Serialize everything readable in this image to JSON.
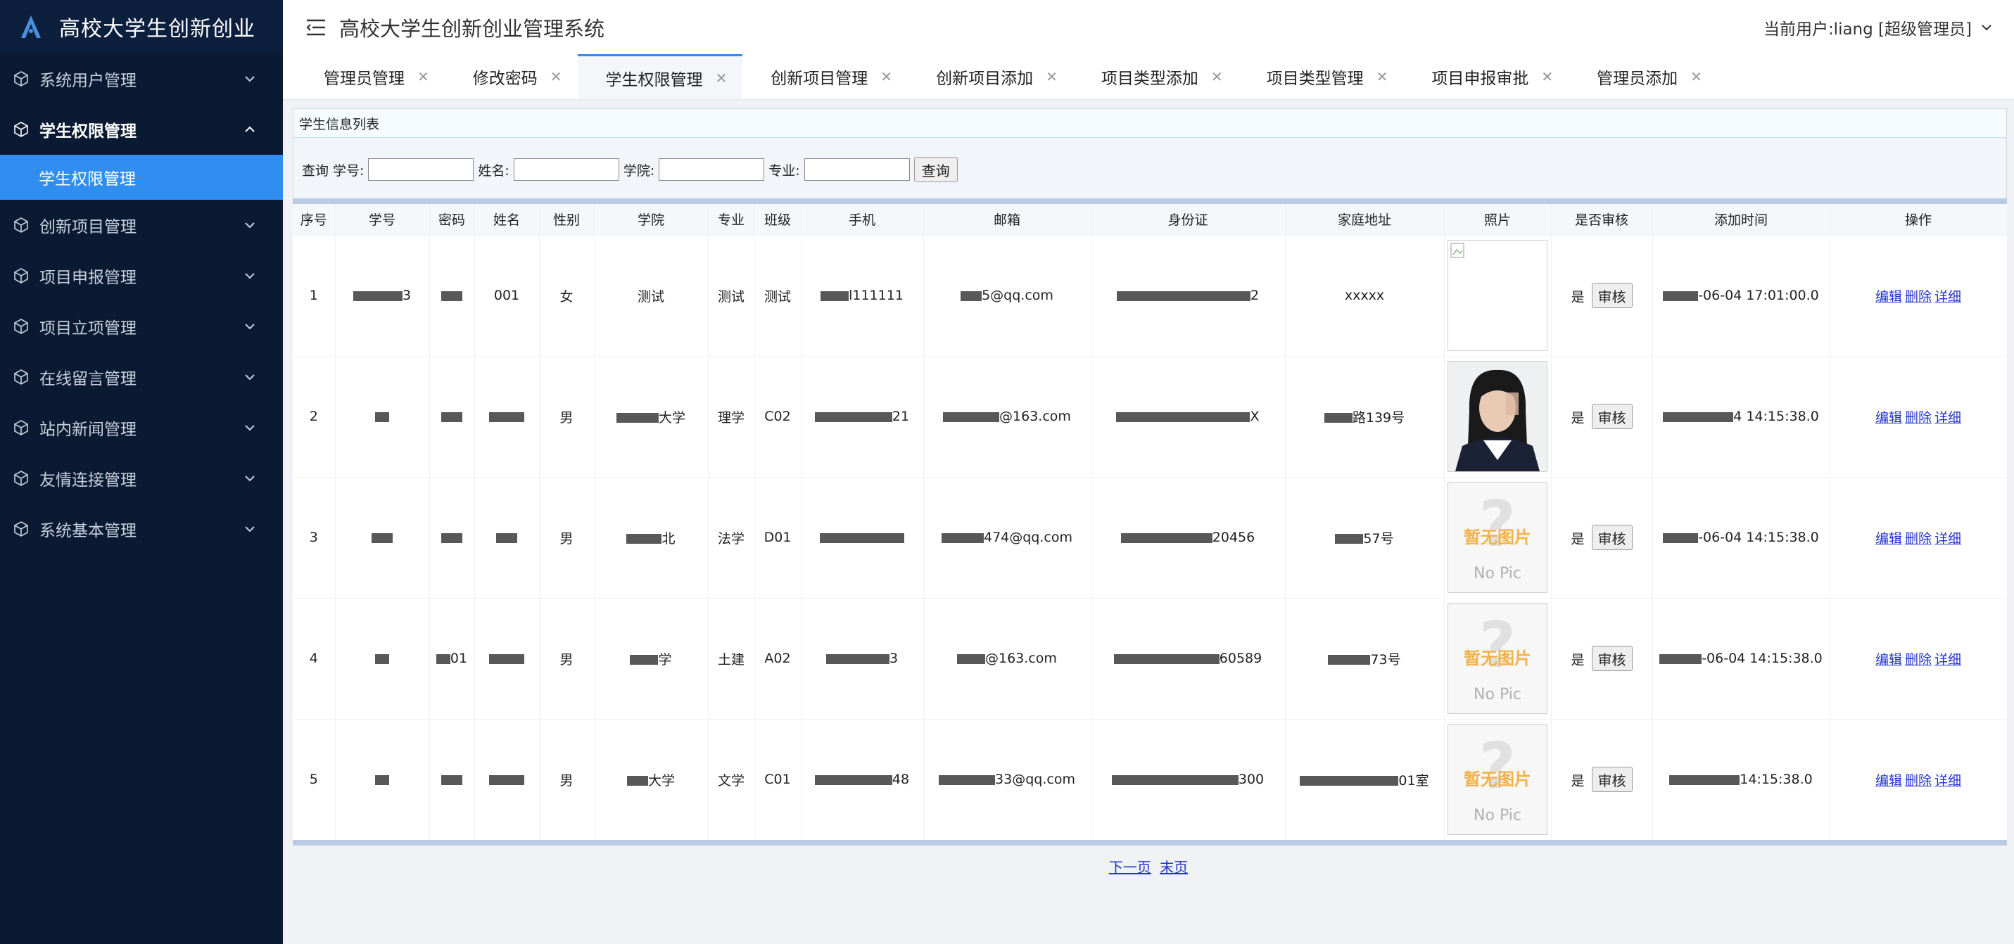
{
  "brand": {
    "title": "高校大学生创新创业"
  },
  "header": {
    "title": "高校大学生创新创业管理系统",
    "user": "当前用户:liang [超级管理员]"
  },
  "sidebar": {
    "items": [
      {
        "label": "系统用户管理",
        "open": false
      },
      {
        "label": "学生权限管理",
        "open": true,
        "sub": [
          "学生权限管理"
        ]
      },
      {
        "label": "创新项目管理",
        "open": false
      },
      {
        "label": "项目申报管理",
        "open": false
      },
      {
        "label": "项目立项管理",
        "open": false
      },
      {
        "label": "在线留言管理",
        "open": false
      },
      {
        "label": "站内新闻管理",
        "open": false
      },
      {
        "label": "友情连接管理",
        "open": false
      },
      {
        "label": "系统基本管理",
        "open": false
      }
    ]
  },
  "tabs": [
    {
      "label": "管理员管理",
      "active": false
    },
    {
      "label": "修改密码",
      "active": false
    },
    {
      "label": "学生权限管理",
      "active": true
    },
    {
      "label": "创新项目管理",
      "active": false
    },
    {
      "label": "创新项目添加",
      "active": false
    },
    {
      "label": "项目类型添加",
      "active": false
    },
    {
      "label": "项目类型管理",
      "active": false
    },
    {
      "label": "项目申报审批",
      "active": false
    },
    {
      "label": "管理员添加",
      "active": false
    }
  ],
  "panel": {
    "title": "学生信息列表"
  },
  "search": {
    "prefix": "查询",
    "fields": [
      "学号:",
      "姓名:",
      "学院:",
      "专业:"
    ],
    "button": "查询"
  },
  "table": {
    "columns": [
      "序号",
      "学号",
      "密码",
      "姓名",
      "性别",
      "学院",
      "专业",
      "班级",
      "手机",
      "邮箱",
      "身份证",
      "家庭地址",
      "照片",
      "是否审核",
      "添加时间",
      "操作"
    ],
    "rows": [
      {
        "no": "1",
        "sid": "3",
        "pwd": "",
        "name": "001",
        "gender": "女",
        "college": "测试",
        "major": "测试",
        "cls": "测试",
        "phone": "l111111",
        "email": "5@qq.com",
        "idcard": "2",
        "address": "xxxxx",
        "photo": "broken",
        "audited": "是",
        "time": "-06-04 17:01:00.0"
      },
      {
        "no": "2",
        "sid": "",
        "pwd": "",
        "name": "",
        "gender": "男",
        "college": "大学",
        "major": "理学",
        "cls": "C02",
        "phone": "21",
        "email": "@163.com",
        "idcard": "X",
        "address": "路139号",
        "photo": "portrait",
        "audited": "是",
        "time": "4 14:15:38.0"
      },
      {
        "no": "3",
        "sid": "",
        "pwd": "",
        "name": "",
        "gender": "男",
        "college": "北",
        "major": "法学",
        "cls": "D01",
        "phone": "",
        "email": "474@qq.com",
        "idcard": "20456",
        "address": "57号",
        "photo": "none",
        "audited": "是",
        "time": "-06-04 14:15:38.0"
      },
      {
        "no": "4",
        "sid": "",
        "pwd": "01",
        "name": "",
        "gender": "男",
        "college": "学",
        "major": "土建",
        "cls": "A02",
        "phone": "3",
        "email": "@163.com",
        "idcard": "60589",
        "address": "73号",
        "photo": "none",
        "audited": "是",
        "time": "-06-04 14:15:38.0"
      },
      {
        "no": "5",
        "sid": "",
        "pwd": "",
        "name": "",
        "gender": "男",
        "college": "大学",
        "major": "文学",
        "cls": "C01",
        "phone": "48",
        "email": "33@qq.com",
        "idcard": "300",
        "address": "01室",
        "photo": "none",
        "audited": "是",
        "time": "14:15:38.0"
      }
    ],
    "review_label": "审核",
    "ops": [
      "编辑",
      "删除",
      "详细"
    ]
  },
  "nopic": {
    "line1": "暂无图片",
    "line2": "No Pic"
  },
  "pager": {
    "next": "下一页",
    "last": "末页"
  },
  "colors": {
    "sidebar_bg": "#0a1a33",
    "accent": "#2f8ef0",
    "link": "#2233cc"
  }
}
